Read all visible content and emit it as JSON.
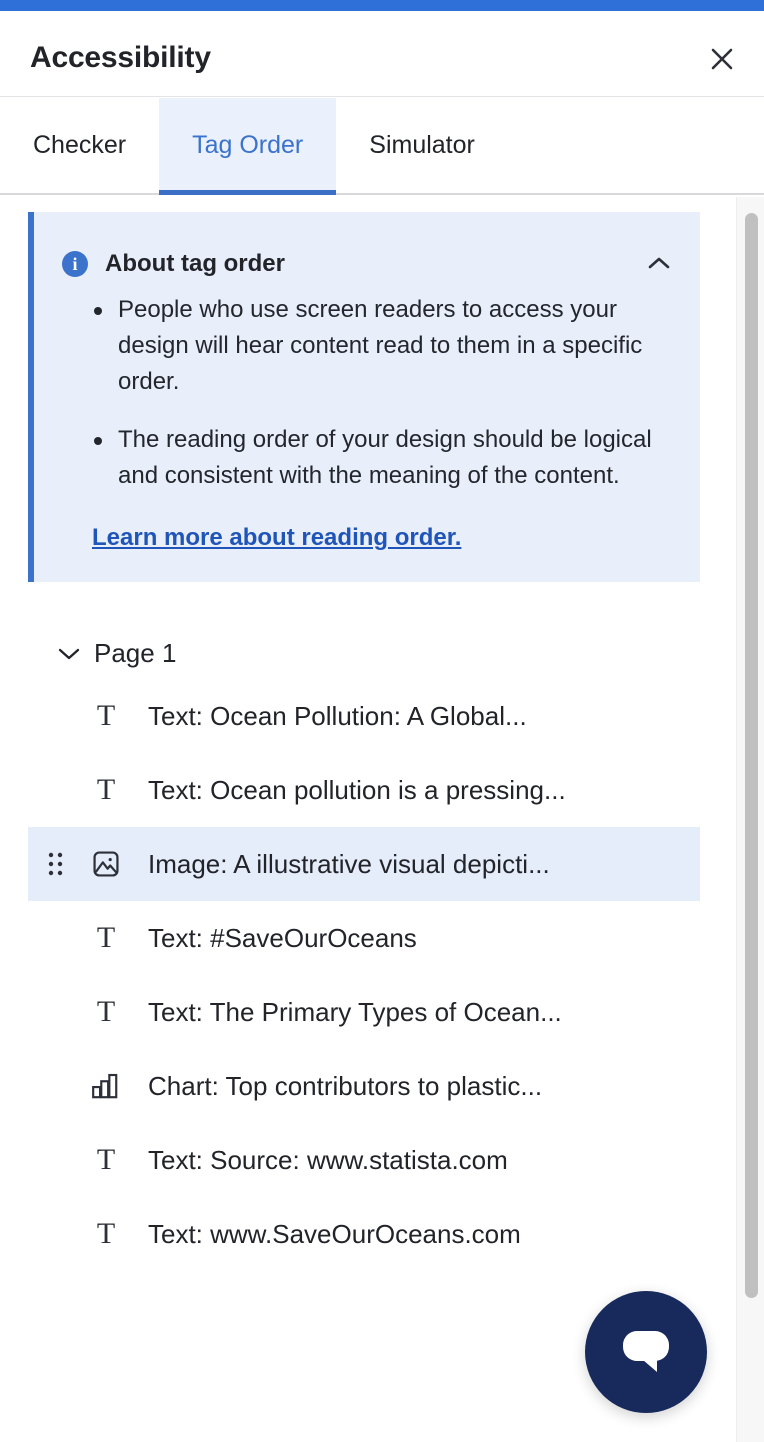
{
  "header": {
    "title": "Accessibility",
    "close_label": "×"
  },
  "tabs": [
    {
      "label": "Checker",
      "active": false
    },
    {
      "label": "Tag Order",
      "active": true
    },
    {
      "label": "Simulator",
      "active": false
    }
  ],
  "info_card": {
    "icon": "info-icon",
    "title": "About tag order",
    "collapse_icon": "chevron-up-icon",
    "bullets": [
      "People who use screen readers to access your design will hear content read to them in a specific order.",
      "The reading order of your design should be logical and consistent with the meaning of the content."
    ],
    "link_text": "Learn more about reading order."
  },
  "tree": {
    "group": {
      "label": "Page 1",
      "expand_icon": "chevron-down-icon",
      "expanded": true
    },
    "items": [
      {
        "icon": "text-icon",
        "label": "Text: Ocean Pollution: A Global...",
        "selected": false,
        "drag": false
      },
      {
        "icon": "text-icon",
        "label": "Text: Ocean pollution is a pressing...",
        "selected": false,
        "drag": false
      },
      {
        "icon": "image-icon",
        "label": "Image: A illustrative visual depicti...",
        "selected": true,
        "drag": true
      },
      {
        "icon": "text-icon",
        "label": "Text: #SaveOurOceans",
        "selected": false,
        "drag": false
      },
      {
        "icon": "text-icon",
        "label": "Text: The Primary Types of Ocean...",
        "selected": false,
        "drag": false
      },
      {
        "icon": "chart-icon",
        "label": "Chart: Top contributors to plastic...",
        "selected": false,
        "drag": false
      },
      {
        "icon": "text-icon",
        "label": "Text: Source: www.statista.com",
        "selected": false,
        "drag": false
      },
      {
        "icon": "text-icon",
        "label": "Text: www.SaveOurOceans.com",
        "selected": false,
        "drag": false
      }
    ]
  },
  "chat": {
    "icon": "chat-bubble-icon"
  },
  "colors": {
    "accent_bar": "#2f70d8",
    "tab_active_text": "#3a72cc",
    "tab_active_bg": "#eaf0fc",
    "info_bg": "#e9eefb",
    "info_border": "#3a72cc",
    "link": "#1f55b8",
    "row_selected_bg": "#e5ecfa",
    "chat_bg": "#182a5c",
    "text": "#22242a"
  }
}
